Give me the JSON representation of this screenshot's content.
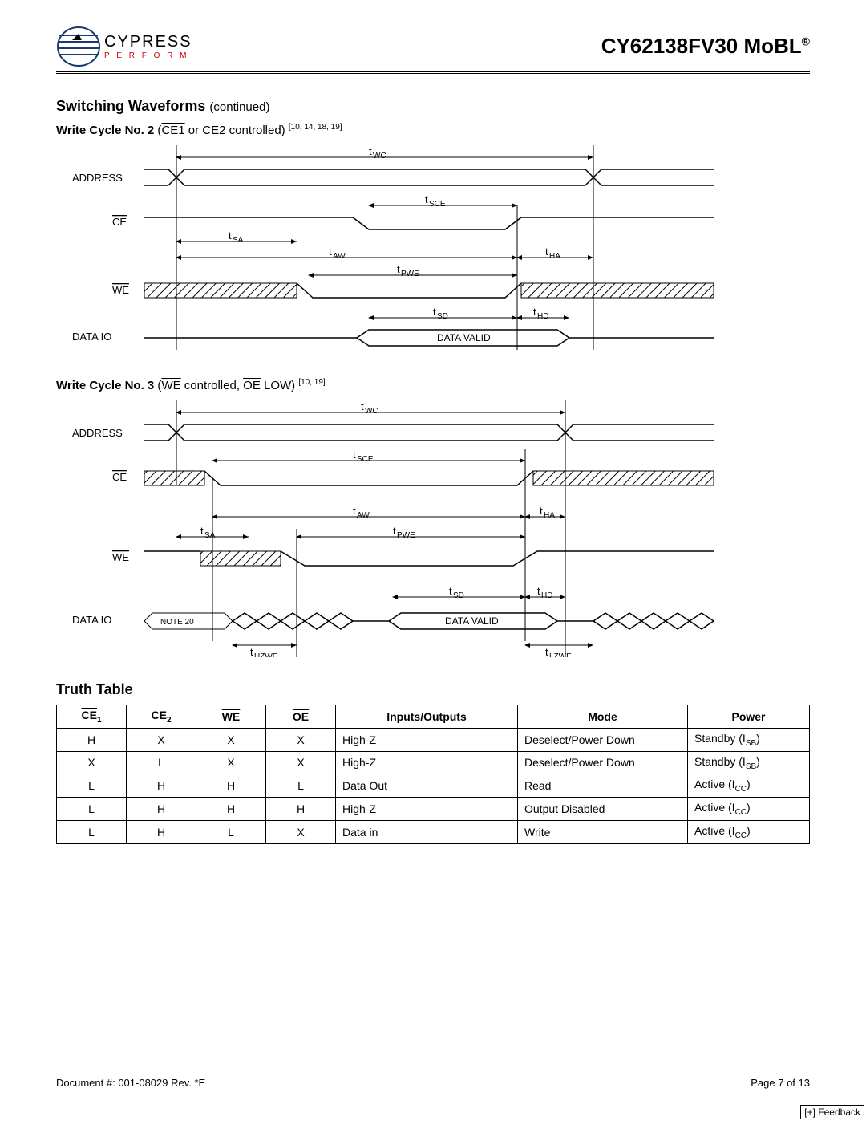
{
  "header": {
    "brand": "CYPRESS",
    "tagline": "P E R F O R M",
    "part": "CY62138FV30 MoBL",
    "reg": "®"
  },
  "sections": {
    "switching_title": "Switching Waveforms",
    "continued": "(continued)",
    "write2_title_bold": "Write Cycle No. 2",
    "write2_title_rest1": " (",
    "write2_title_bar1": "CE1",
    "write2_title_rest2": " or CE2 controlled) ",
    "write2_refs": "[10, 14, 18, 19]",
    "write3_title_bold": "Write Cycle No. 3",
    "write3_title_rest1": " (",
    "write3_title_bar1": "WE",
    "write3_title_rest2": " controlled, ",
    "write3_title_bar2": "OE",
    "write3_title_rest3": " LOW) ",
    "write3_refs": "[10, 19]",
    "truth_table_title": "Truth Table"
  },
  "diagram1_labels": {
    "address": "ADDRESS",
    "ce": "CE",
    "we": "WE",
    "dataio": "DATA  IO",
    "twc": "tWC",
    "tsce": "tSCE",
    "tsa": "tSA",
    "taw": "tAW",
    "tha": "tHA",
    "tpwe": "tPWE",
    "tsd": "tSD",
    "thd": "tHD",
    "data_valid": "DATA VALID"
  },
  "diagram2_labels": {
    "address": "ADDRESS",
    "ce": "CE",
    "we": "WE",
    "dataio": "DATA  IO",
    "twc": "tWC",
    "tsce": "tSCE",
    "tsa": "tSA",
    "taw": "tAW",
    "tha": "tHA",
    "tpwe": "tPWE",
    "tsd": "tSD",
    "thd": "tHD",
    "thzwe": "tHZWE",
    "tlzwe": "tLZWE",
    "note20": "NOTE 20",
    "data_valid": "DATA VALID"
  },
  "truth_table": {
    "headers": {
      "ce1": "CE",
      "ce1_sub": "1",
      "ce2": "CE",
      "ce2_sub": "2",
      "we": "WE",
      "oe": "OE",
      "io": "Inputs/Outputs",
      "mode": "Mode",
      "power": "Power"
    },
    "rows": [
      {
        "ce1": "H",
        "ce2": "X",
        "we": "X",
        "oe": "X",
        "io": "High-Z",
        "mode": "Deselect/Power Down",
        "power": "Standby (I",
        "psub": "SB",
        "pend": ")"
      },
      {
        "ce1": "X",
        "ce2": "L",
        "we": "X",
        "oe": "X",
        "io": "High-Z",
        "mode": "Deselect/Power Down",
        "power": "Standby (I",
        "psub": "SB",
        "pend": ")"
      },
      {
        "ce1": "L",
        "ce2": "H",
        "we": "H",
        "oe": "L",
        "io": "Data Out",
        "mode": "Read",
        "power": "Active (I",
        "psub": "CC",
        "pend": ")"
      },
      {
        "ce1": "L",
        "ce2": "H",
        "we": "H",
        "oe": "H",
        "io": "High-Z",
        "mode": "Output Disabled",
        "power": "Active (I",
        "psub": "CC",
        "pend": ")"
      },
      {
        "ce1": "L",
        "ce2": "H",
        "we": "L",
        "oe": "X",
        "io": "Data in",
        "mode": "Write",
        "power": "Active (I",
        "psub": "CC",
        "pend": ")"
      }
    ]
  },
  "footer": {
    "docnum": "Document #: 001-08029 Rev. *E",
    "page": "Page 7 of 13",
    "feedback": "[+] Feedback"
  }
}
